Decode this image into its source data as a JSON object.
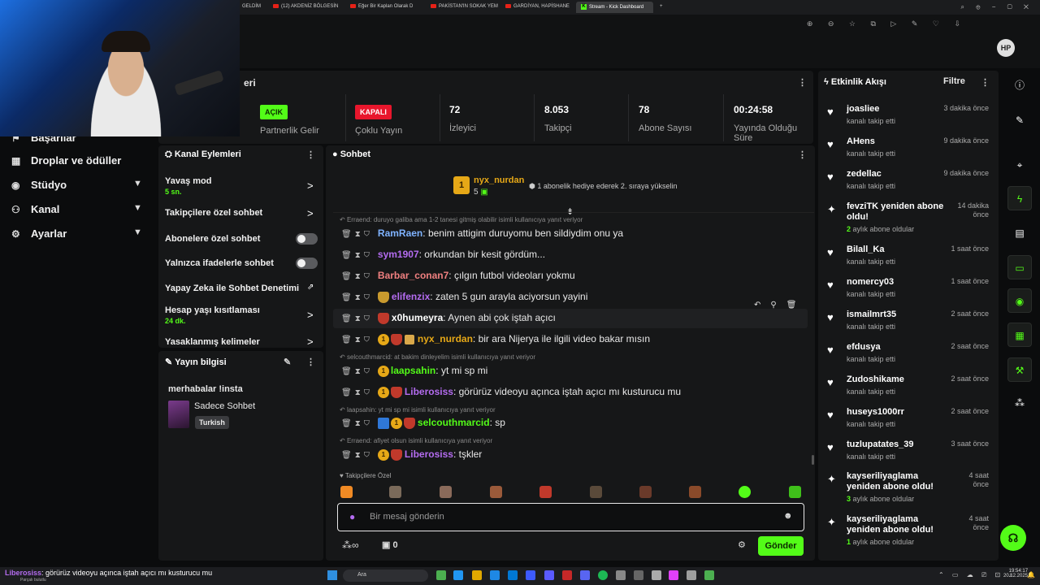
{
  "browser": {
    "tabs": [
      {
        "label": "GELDİM"
      },
      {
        "label": "(12) AKDENİZ BÖLGESİN"
      },
      {
        "label": "Eğer Bir Kaplan Olarak D"
      },
      {
        "label": "PAKİSTAN'IN SOKAK YEM"
      },
      {
        "label": "GARDİYAN, HAPİSHANE"
      },
      {
        "label": "Stream - Kick Dashboard"
      }
    ],
    "logo": "HP"
  },
  "nav": {
    "items": [
      {
        "label": "Başarılar",
        "icon": "trophy-icon"
      },
      {
        "label": "Droplar ve ödüller",
        "icon": "gift-icon"
      },
      {
        "label": "Stüdyo",
        "icon": "camera-icon"
      },
      {
        "label": "Kanal",
        "icon": "users-icon"
      },
      {
        "label": "Ayarlar",
        "icon": "gear-icon"
      }
    ]
  },
  "stats": {
    "title": "eri",
    "partner": {
      "badge": "AÇIK",
      "label": "Partnerlik Gelir"
    },
    "multi": {
      "badge": "KAPALI",
      "label": "Çoklu Yayın"
    },
    "viewers": {
      "value": "72",
      "label": "İzleyici"
    },
    "followers": {
      "value": "8.053",
      "label": "Takipçi"
    },
    "subs": {
      "value": "78",
      "label": "Abone Sayısı"
    },
    "uptime": {
      "value": "00:24:58",
      "label": "Yayında Olduğu Süre"
    }
  },
  "channel_actions": {
    "title": "Kanal Eylemleri",
    "items": [
      {
        "label": "Yavaş mod",
        "sub": "5 sn."
      },
      {
        "label": "Takipçilere özel sohbet"
      },
      {
        "label": "Abonelere özel sohbet"
      },
      {
        "label": "Yalnızca ifadelerle sohbet"
      },
      {
        "label": "Yapay Zeka ile Sohbet Denetimi"
      },
      {
        "label": "Hesap yaşı kısıtlaması",
        "sub": "24 dk."
      },
      {
        "label": "Yasaklanmış kelimeler"
      }
    ]
  },
  "stream_info": {
    "title": "Yayın bilgisi",
    "stream_title": "merhabalar !insta",
    "category": "Sadece Sohbet",
    "language": "Turkish"
  },
  "chat": {
    "title": "Sohbet",
    "pinned": {
      "user": "nyx_nurdan",
      "count": "5",
      "message": "1 abonelik hediye ederek 2. sıraya yükselin"
    },
    "lines": [
      {
        "reply": "Erraend: duruyo galiba ama 1-2 tanesi gitmiş olabilir isimli kullanıcıya yanıt veriyor",
        "user": "RamRaen",
        "color": "#7fb3ff",
        "text": "benim attigim duruyomu ben sildiydim onu ya"
      },
      {
        "user": "sym1907",
        "color": "#b46cf0",
        "text": "orkundan bir kesit gördüm..."
      },
      {
        "user": "Barbar_conan7",
        "color": "#f08080",
        "text": "çılgın futbol videoları yokmu"
      },
      {
        "user": "elifenzix",
        "color": "#b46cf0",
        "text": "zaten 5 gun arayla aciyorsun yayini"
      },
      {
        "user": "x0humeyra",
        "color": "#ffffff",
        "text": "Aynen abi çok iştah açıcı"
      },
      {
        "user": "nyx_nurdan",
        "color": "#e6a817",
        "text": "bir ara Nijerya ile ilgili video bakar mısın"
      },
      {
        "reply": "selcouthmarcid: at bakim dinleyelim isimli kullanıcıya yanıt veriyor",
        "user": "laapsahin",
        "color": "#53fc18",
        "text": "yt mi sp mi"
      },
      {
        "user": "Liberosiss",
        "color": "#b46cf0",
        "text": "görürüz videoyu açınca iştah açıcı mı kusturucu mu"
      },
      {
        "reply": "laapsahin: yt mi sp mi isimli kullanıcıya yanıt veriyor",
        "user": "selcouthmarcid",
        "color": "#53fc18",
        "text": "sp"
      },
      {
        "reply": "Erraend: afiyet olsun isimli kullanıcıya yanıt veriyor",
        "user": "Liberosiss",
        "color": "#b46cf0",
        "text": "tşkler"
      }
    ],
    "emote_bar_label": "Takipçilere Özel",
    "input_placeholder": "Bir mesaj gönderin",
    "gift_count": "0",
    "send_label": "Gönder"
  },
  "activity": {
    "title": "Etkinlik Akışı",
    "filter": "Filtre",
    "items": [
      {
        "type": "follow",
        "name": "joasliee",
        "desc": "kanalı takip etti",
        "time": "3 dakika önce"
      },
      {
        "type": "follow",
        "name": "AHens",
        "desc": "kanalı takip etti",
        "time": "9 dakika önce"
      },
      {
        "type": "follow",
        "name": "zedellac",
        "desc": "kanalı takip etti",
        "time": "9 dakika önce"
      },
      {
        "type": "sub",
        "name": "fevziTK yeniden abone oldu!",
        "months": "2",
        "desc": "aylık abone oldular",
        "time": "14 dakika önce"
      },
      {
        "type": "follow",
        "name": "Bilall_Ka",
        "desc": "kanalı takip etti",
        "time": "1 saat önce"
      },
      {
        "type": "follow",
        "name": "nomercy03",
        "desc": "kanalı takip etti",
        "time": "1 saat önce"
      },
      {
        "type": "follow",
        "name": "ismailmrt35",
        "desc": "kanalı takip etti",
        "time": "2 saat önce"
      },
      {
        "type": "follow",
        "name": "efdusya",
        "desc": "kanalı takip etti",
        "time": "2 saat önce"
      },
      {
        "type": "follow",
        "name": "Zudoshikame",
        "desc": "kanalı takip etti",
        "time": "2 saat önce"
      },
      {
        "type": "follow",
        "name": "huseys1000rr",
        "desc": "kanalı takip etti",
        "time": "2 saat önce"
      },
      {
        "type": "follow",
        "name": "tuzlupatates_39",
        "desc": "kanalı takip etti",
        "time": "3 saat önce"
      },
      {
        "type": "sub",
        "name": "kayseriliyaglama yeniden abone oldu!",
        "months": "3",
        "desc": "aylık abone oldular",
        "time": "4 saat önce"
      },
      {
        "type": "sub",
        "name": "kayseriliyaglama yeniden abone oldu!",
        "months": "1",
        "desc": "aylık abone oldular",
        "time": "4 saat önce"
      }
    ]
  },
  "taskbar": {
    "notification_user": "Liberosiss",
    "notification_text": "görürüz videoyu açınca iştah açıcı mı kusturucu mu",
    "notification_sub": "Parçalı bulutlu",
    "search": "Ara",
    "time": "19:54:17",
    "date": "20.12.2025"
  },
  "colors": {
    "accent": "#53fc18",
    "danger": "#e8162c",
    "panel": "#161718",
    "bg": "#0b0c0d"
  }
}
